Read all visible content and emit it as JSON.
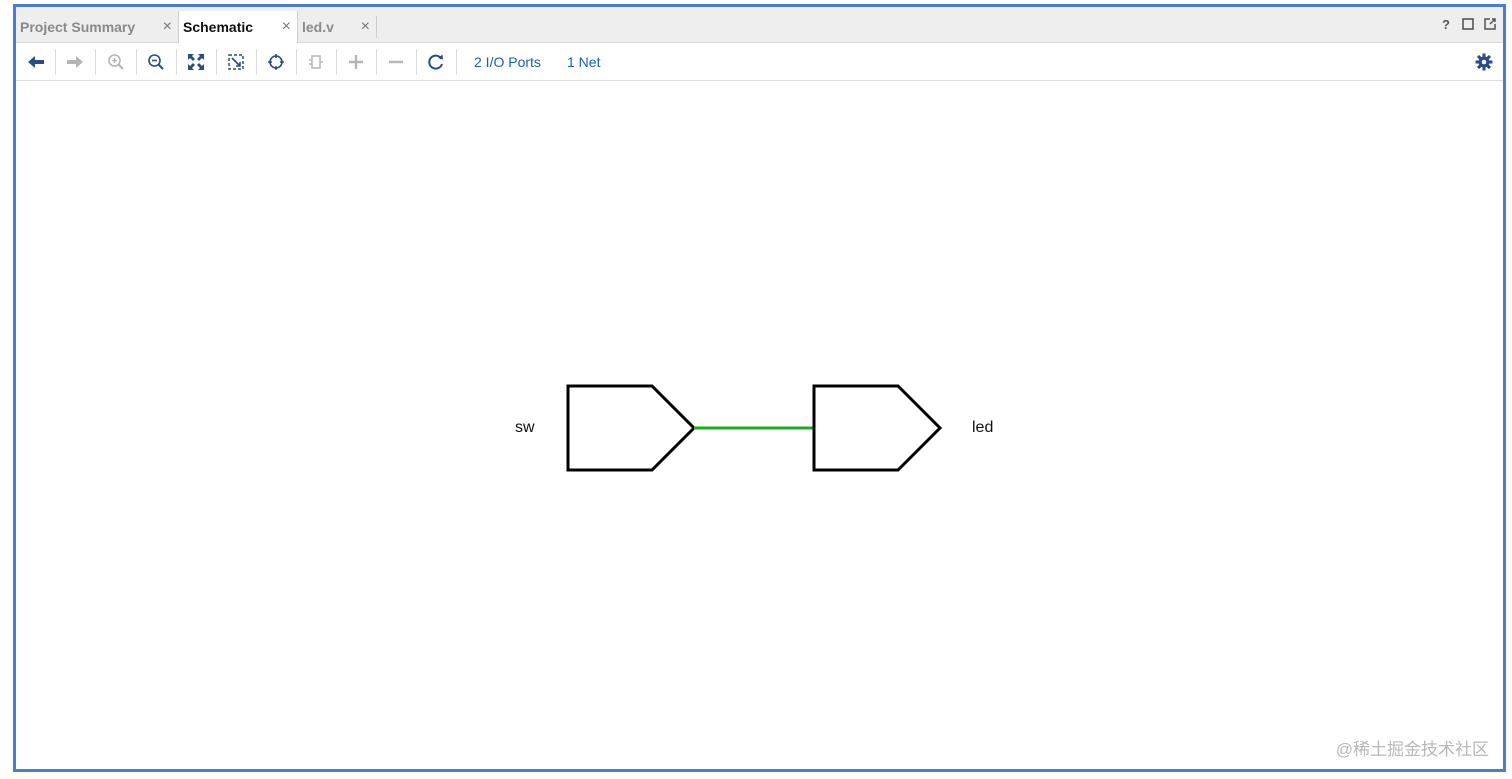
{
  "tabs": [
    {
      "label": "Project Summary",
      "active": false
    },
    {
      "label": "Schematic",
      "active": true
    },
    {
      "label": "led.v",
      "active": false
    }
  ],
  "tab_close_glyph": "×",
  "window_controls": {
    "help": "?",
    "icons": [
      "help-icon",
      "maximize-icon",
      "float-window-icon"
    ]
  },
  "toolbar": {
    "icons": [
      "back-arrow-icon",
      "forward-arrow-icon",
      "zoom-in-icon",
      "zoom-out-icon",
      "zoom-fit-icon",
      "zoom-area-icon",
      "select-target-icon",
      "expand-cell-icon",
      "add-icon",
      "remove-icon",
      "refresh-icon"
    ],
    "io_ports_label": "2 I/O Ports",
    "nets_label": "1 Net",
    "settings_icon": "gear-icon"
  },
  "schematic": {
    "input_port": "sw",
    "output_port": "led",
    "net_color": "#1cae1c"
  },
  "watermark": "@稀土掘金技术社区",
  "colors": {
    "frame_border": "#4a7dcc",
    "toolbar_icon": "#2a4b86",
    "toolbar_icon_disabled": "#b5b5b5",
    "link": "#1a5fb4"
  }
}
